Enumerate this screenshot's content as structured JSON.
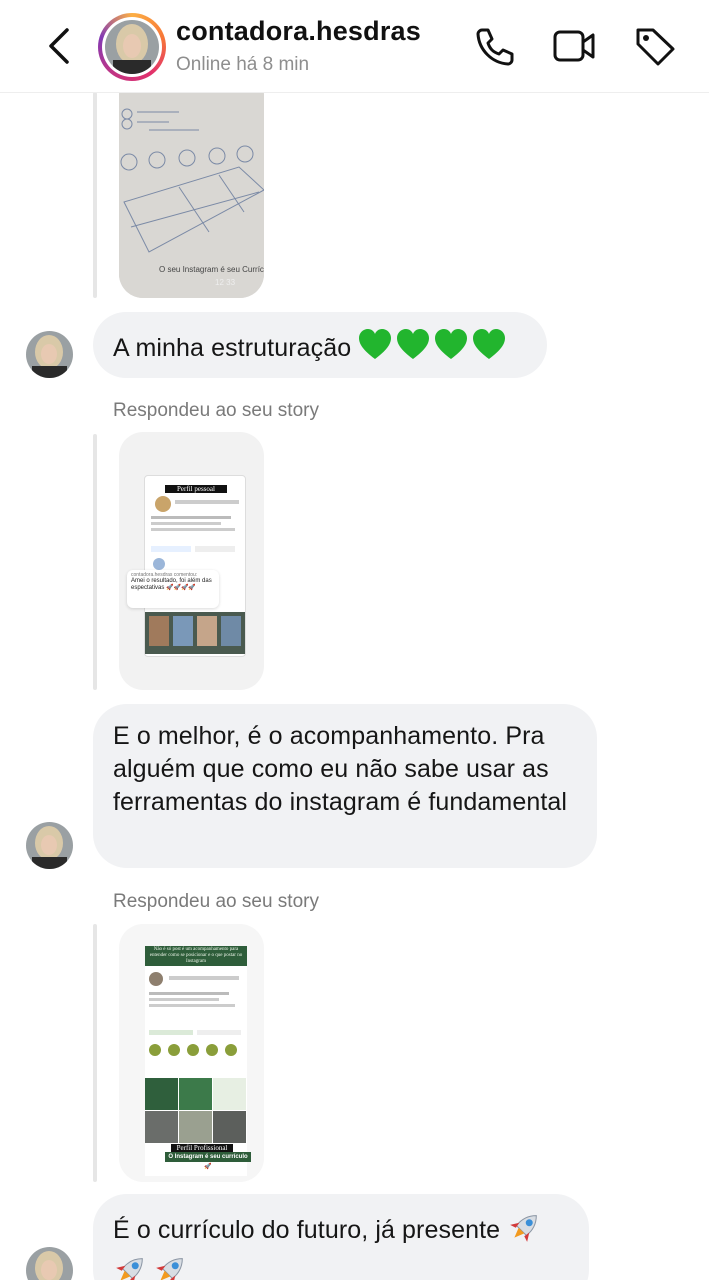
{
  "header": {
    "username": "contadora.hesdras",
    "status": "Online há 8 min"
  },
  "colors": {
    "heart_green": "#1fbf2b",
    "bubble_bg": "#f1f2f4",
    "muted_text": "#7a7a7a"
  },
  "icons": [
    "back-arrow-icon",
    "phone-icon",
    "video-camera-icon",
    "tag-icon",
    "green-heart-icon",
    "rocket-icon"
  ],
  "messages": [
    {
      "type": "story_reply_image",
      "story_text": "O seu Instagram é seu Currículo",
      "story_time": "12 33"
    },
    {
      "type": "text",
      "text": "A minha estruturação",
      "emoji": "💚💚💚💚"
    },
    {
      "type": "story_reply",
      "label": "Respondeu ao seu story",
      "story_title": "Perfil pessoal",
      "comment_author": "contadora.hesdras comentou:",
      "comment_text": "Amei o resultado, foi além das espectativas 🚀🚀🚀🚀"
    },
    {
      "type": "text",
      "text": "E o melhor, é o acompanhamento. Pra alguém que como eu não sabe usar as ferramentas do instagram é fundamental"
    },
    {
      "type": "story_reply",
      "label": "Respondeu ao seu story",
      "story_banner": "Não é só post é um acompanhamento para entender como se posicionar e o que postar no Instagram",
      "story_title": "Perfil Profissional",
      "story_caption": "O Instagram é seu currículo 🚀"
    },
    {
      "type": "text",
      "text": "É o currículo do futuro, já presente",
      "emoji": "🚀🚀🚀"
    }
  ]
}
